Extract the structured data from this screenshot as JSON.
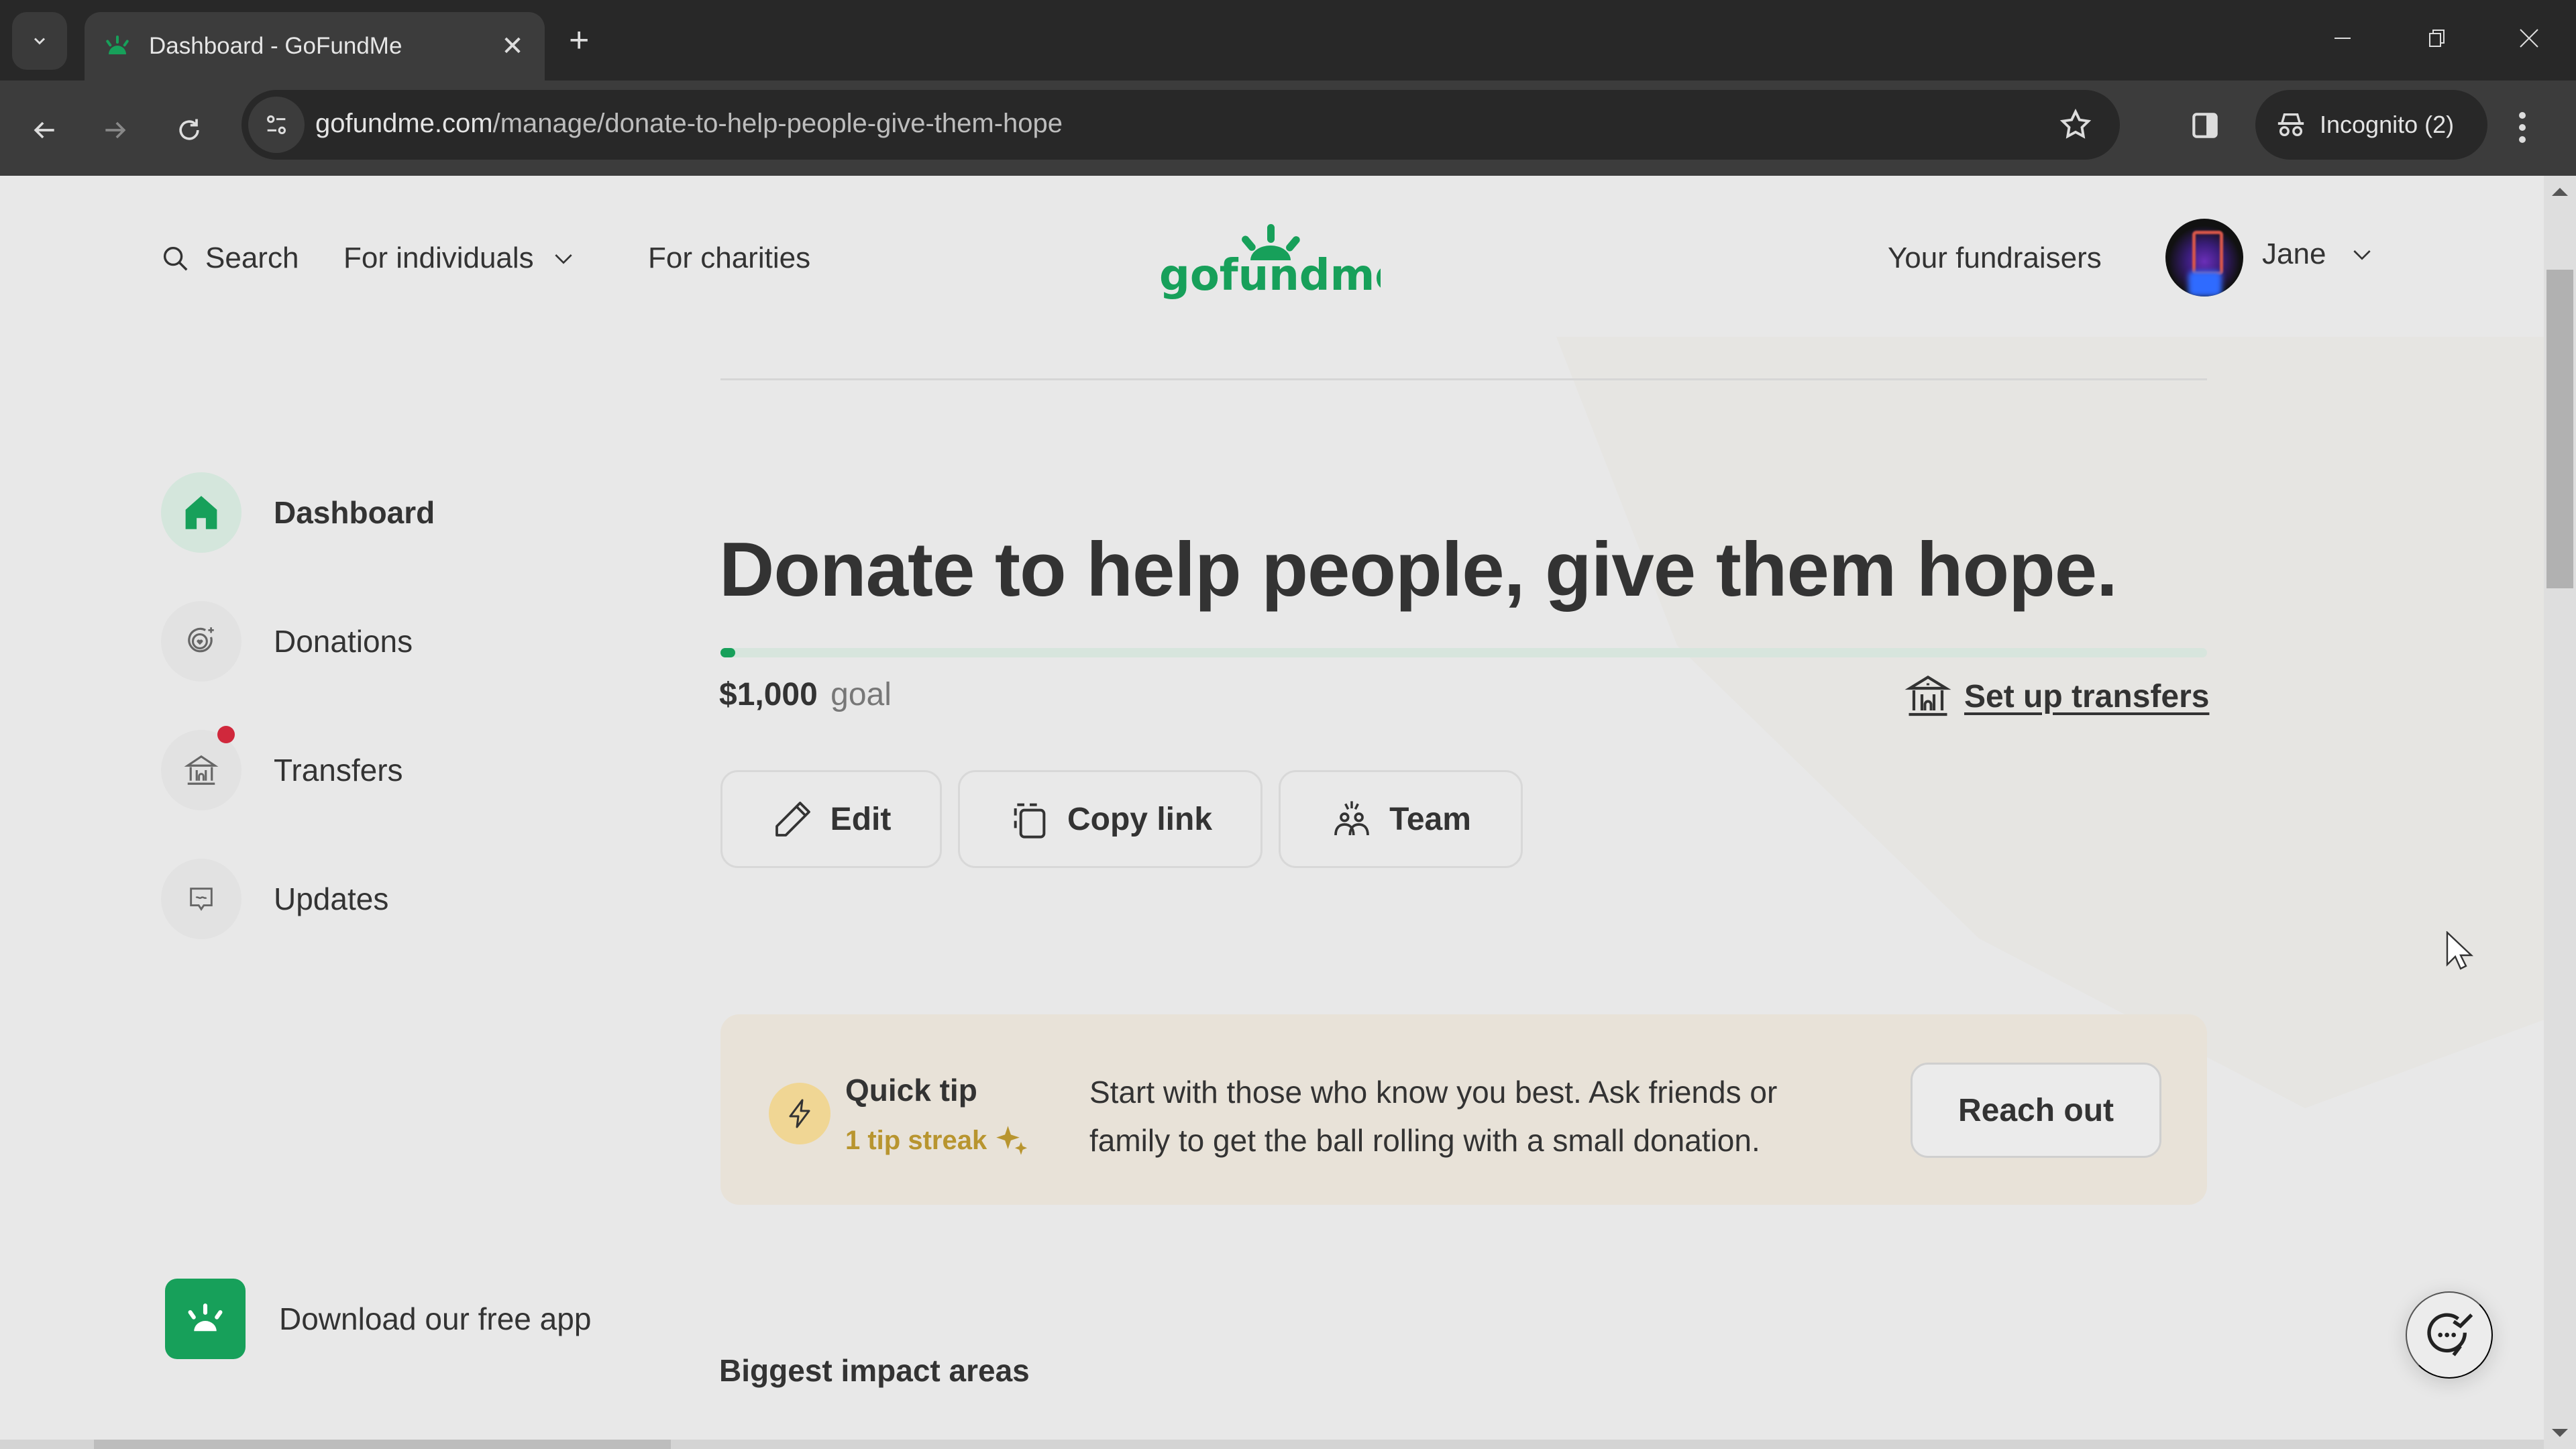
{
  "browser": {
    "tab_title": "Dashboard - GoFundMe",
    "url_domain": "gofundme.com",
    "url_path": "/manage/donate-to-help-people-give-them-hope",
    "incognito_label": "Incognito (2)"
  },
  "header": {
    "search_label": "Search",
    "for_individuals_label": "For individuals",
    "for_charities_label": "For charities",
    "logo_text": "gofundme",
    "your_fundraisers_label": "Your fundraisers",
    "user_name": "Jane"
  },
  "sidebar": {
    "items": [
      {
        "label": "Dashboard",
        "icon": "home-icon",
        "active": true
      },
      {
        "label": "Donations",
        "icon": "donations-heart-icon",
        "active": false
      },
      {
        "label": "Transfers",
        "icon": "bank-icon",
        "active": false,
        "notification": true
      },
      {
        "label": "Updates",
        "icon": "updates-message-icon",
        "active": false
      }
    ],
    "download_app_label": "Download our free app"
  },
  "campaign": {
    "title": "Donate to help people, give them hope.",
    "progress_percent": 0,
    "goal_amount": "$1,000",
    "goal_label": "goal",
    "setup_transfers_label": "Set up transfers",
    "actions": {
      "edit_label": "Edit",
      "copy_link_label": "Copy link",
      "team_label": "Team"
    }
  },
  "quick_tip": {
    "title": "Quick tip",
    "streak": "1 tip streak",
    "text": "Start with those who know you best. Ask friends or family to get the ball rolling with a small donation.",
    "button_label": "Reach out"
  },
  "sections": {
    "biggest_impact_heading": "Biggest impact areas"
  },
  "colors": {
    "brand_green": "#17a05a",
    "progress_track": "#d7e5dd",
    "notification_red": "#d0283c",
    "tip_background": "#e8e2d8",
    "tip_accent": "#b8952f"
  }
}
